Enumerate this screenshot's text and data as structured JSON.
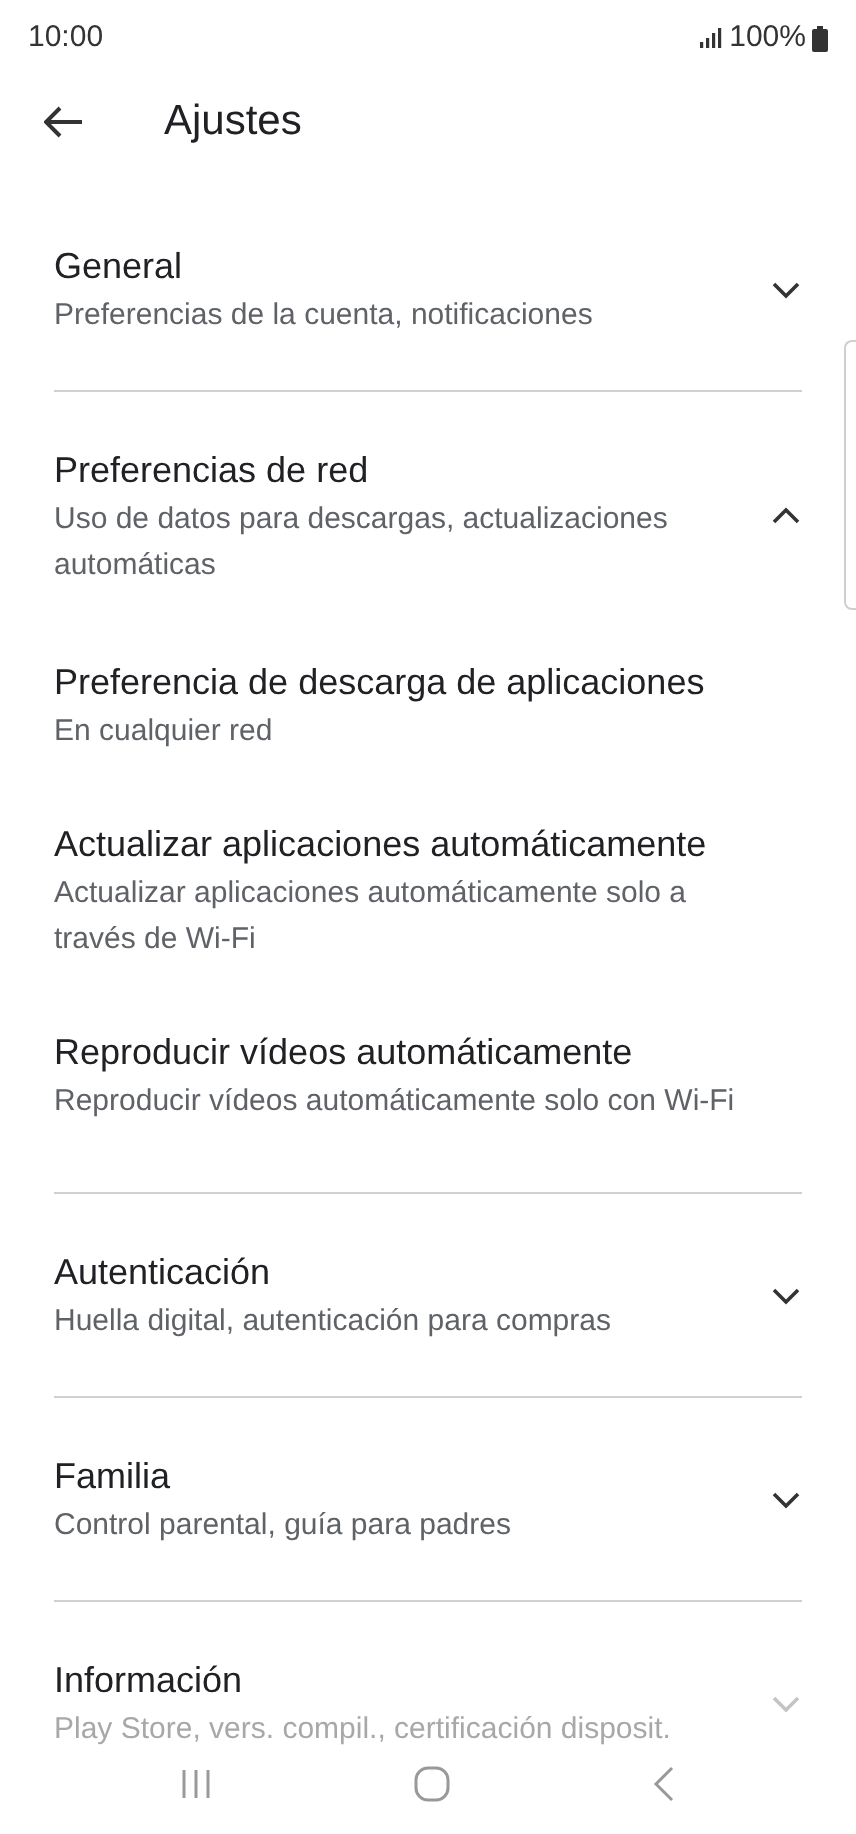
{
  "status_bar": {
    "time": "10:00",
    "battery": "100%"
  },
  "header": {
    "title": "Ajustes"
  },
  "sections": [
    {
      "title": "General",
      "subtitle": "Preferencias de la cuenta, notificaciones",
      "expanded": false,
      "faded": false
    },
    {
      "title": "Preferencias de red",
      "subtitle": "Uso de datos para descargas, actualizaciones automáticas",
      "expanded": true,
      "faded": false,
      "children": [
        {
          "title": "Preferencia de descarga de aplicaciones",
          "subtitle": "En cualquier red"
        },
        {
          "title": "Actualizar aplicaciones automáticamente",
          "subtitle": "Actualizar aplicaciones automáticamente solo a través de Wi-Fi"
        },
        {
          "title": "Reproducir vídeos automáticamente",
          "subtitle": "Reproducir vídeos automáticamente solo con Wi-Fi"
        }
      ]
    },
    {
      "title": "Autenticación",
      "subtitle": "Huella digital, autenticación para compras",
      "expanded": false,
      "faded": false
    },
    {
      "title": "Familia",
      "subtitle": "Control parental, guía para padres",
      "expanded": false,
      "faded": false
    },
    {
      "title": "Información",
      "subtitle": "Play Store, vers. compil., certificación disposit.",
      "expanded": false,
      "faded": true
    }
  ]
}
